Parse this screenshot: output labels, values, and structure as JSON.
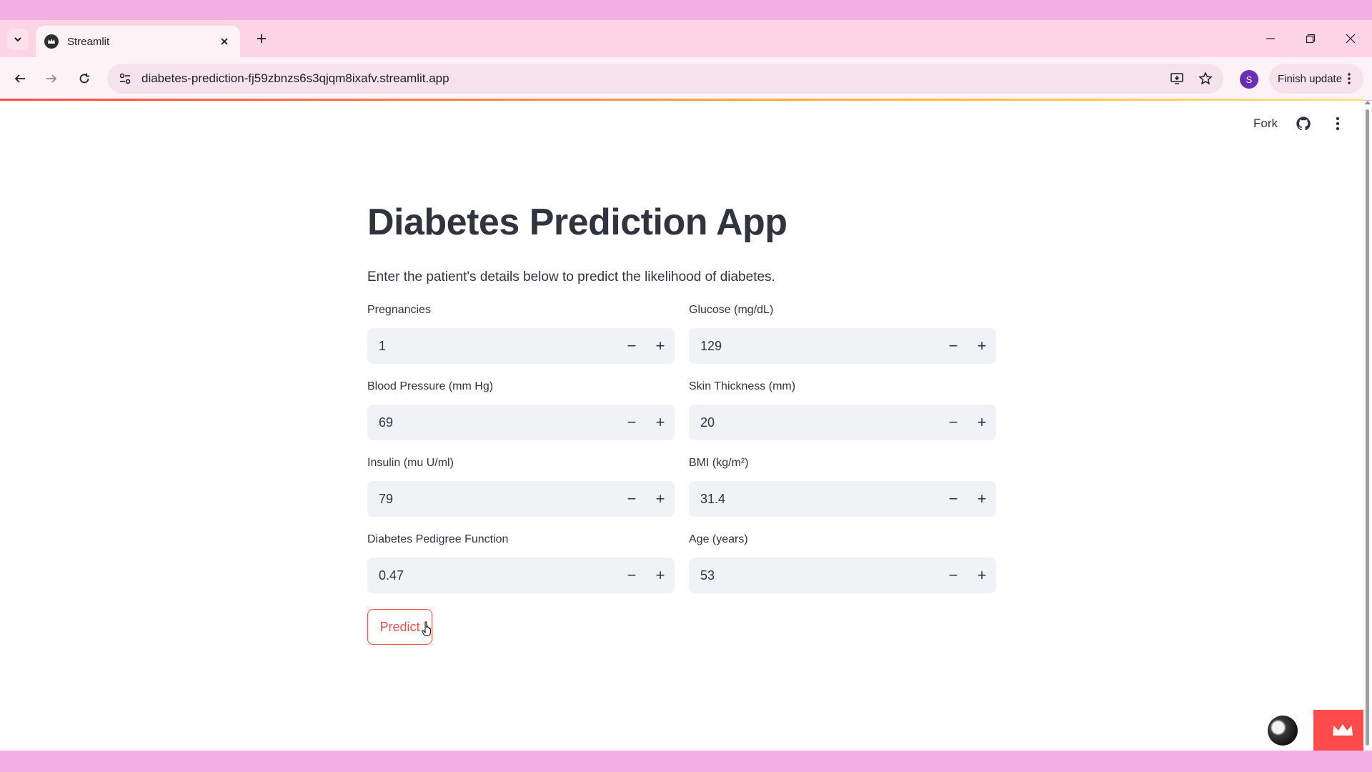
{
  "browser": {
    "tab_title": "Streamlit",
    "url": "diabetes-prediction-fj59zbnzs6s3qjqm8ixafv.streamlit.app",
    "profile_initial": "S",
    "finish_update_label": "Finish update"
  },
  "header": {
    "fork_label": "Fork"
  },
  "main": {
    "title": "Diabetes Prediction App",
    "subtitle": "Enter the patient's details below to predict the likelihood of diabetes.",
    "fields": [
      {
        "label": "Pregnancies",
        "value": "1"
      },
      {
        "label": "Glucose (mg/dL)",
        "value": "129"
      },
      {
        "label": "Blood Pressure (mm Hg)",
        "value": "69"
      },
      {
        "label": "Skin Thickness (mm)",
        "value": "20"
      },
      {
        "label": "Insulin (mu U/ml)",
        "value": "79"
      },
      {
        "label": "BMI (kg/m²)",
        "value": "31.4"
      },
      {
        "label": "Diabetes Pedigree Function",
        "value": "0.47"
      },
      {
        "label": "Age (years)",
        "value": "53"
      }
    ],
    "minus_glyph": "−",
    "plus_glyph": "+",
    "predict_label": "Predict"
  },
  "colors": {
    "accent": "#ff4b4b",
    "input_bg": "#f0f2f6",
    "text": "#31333f",
    "frame": "#f3aee4"
  }
}
